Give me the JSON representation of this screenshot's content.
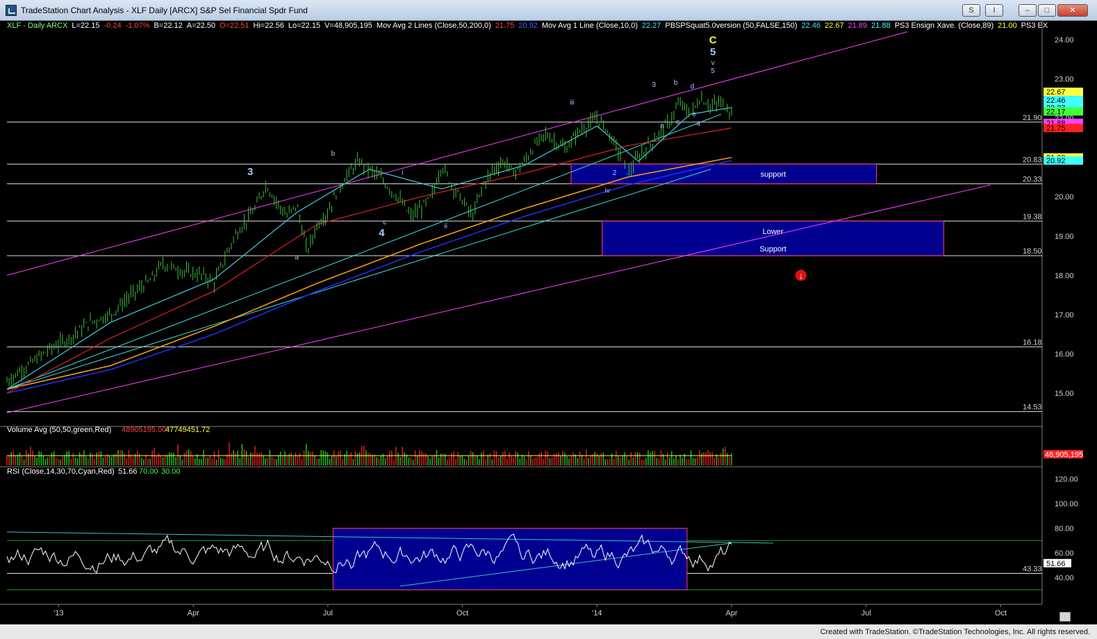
{
  "window": {
    "title": "TradeStation Chart Analysis - XLF Daily [ARCX] S&P Sel Financial Spdr Fund",
    "controls": [
      "S",
      "I",
      "–",
      "□",
      "✕"
    ]
  },
  "header": {
    "line": [
      {
        "text": "XLF - Daily  ARCX",
        "color": "#80ff80"
      },
      {
        "text": "L=22.15",
        "color": "#ffffff"
      },
      {
        "text": "-0.24",
        "color": "#ff4040"
      },
      {
        "text": "-1.07%",
        "color": "#ff4040"
      },
      {
        "text": "B=22.12",
        "color": "#ffffff"
      },
      {
        "text": "A=22.50",
        "color": "#ffffff"
      },
      {
        "text": "O=22.51",
        "color": "#ff4040"
      },
      {
        "text": "Hi=22.56",
        "color": "#ffffff"
      },
      {
        "text": "Lo=22.15",
        "color": "#ffffff"
      },
      {
        "text": "V=48,905,195",
        "color": "#ffffff"
      },
      {
        "text": "Mov Avg 2 Lines (Close,50,200,0)",
        "color": "#ffffff"
      },
      {
        "text": "21.75",
        "color": "#ff4040"
      },
      {
        "text": "20.92",
        "color": "#4060ff"
      },
      {
        "text": "Mov Avg 1 Line (Close,10,0)",
        "color": "#ffffff"
      },
      {
        "text": "22.27",
        "color": "#40e0ff"
      },
      {
        "text": "PBSPSquat5.0version (50,FALSE,150)",
        "color": "#ffffff"
      },
      {
        "text": "22.46",
        "color": "#40e0ff"
      },
      {
        "text": "22.67",
        "color": "#ffff40"
      },
      {
        "text": "21.89",
        "color": "#ff40ff"
      },
      {
        "text": "21.88",
        "color": "#40ffff"
      },
      {
        "text": "PS3 Ensign Xave. (Close,89)",
        "color": "#ffffff"
      },
      {
        "text": "21.00",
        "color": "#ffff40"
      },
      {
        "text": "PS3 EX",
        "color": "#ffffff"
      }
    ]
  },
  "chart_data": [
    {
      "type": "line",
      "subtype": "candlestick-price",
      "symbol": "XLF",
      "ylim": [
        14.4,
        24.3
      ],
      "yticks": [
        15.0,
        16.0,
        17.0,
        18.0,
        19.0,
        20.0,
        21.0,
        22.0,
        23.0,
        24.0
      ],
      "xlabels": [
        "'13",
        "Apr",
        "Jul",
        "Oct",
        "'14",
        "Apr",
        "Jul",
        "Oct"
      ],
      "x_positions": [
        0.05,
        0.18,
        0.31,
        0.44,
        0.57,
        0.7,
        0.83,
        0.96
      ],
      "price_path": [
        [
          0.0,
          15.3
        ],
        [
          0.02,
          15.7
        ],
        [
          0.04,
          16.1
        ],
        [
          0.06,
          16.4
        ],
        [
          0.08,
          16.8
        ],
        [
          0.1,
          17.0
        ],
        [
          0.12,
          17.5
        ],
        [
          0.14,
          17.9
        ],
        [
          0.15,
          18.3
        ],
        [
          0.17,
          18.1
        ],
        [
          0.19,
          18.0
        ],
        [
          0.2,
          17.8
        ],
        [
          0.21,
          18.4
        ],
        [
          0.22,
          19.0
        ],
        [
          0.24,
          19.7
        ],
        [
          0.25,
          20.3
        ],
        [
          0.26,
          19.9
        ],
        [
          0.27,
          19.5
        ],
        [
          0.28,
          19.8
        ],
        [
          0.29,
          18.6
        ],
        [
          0.3,
          19.3
        ],
        [
          0.31,
          19.6
        ],
        [
          0.32,
          20.2
        ],
        [
          0.33,
          20.6
        ],
        [
          0.34,
          20.9
        ],
        [
          0.35,
          20.7
        ],
        [
          0.36,
          20.5
        ],
        [
          0.37,
          20.2
        ],
        [
          0.38,
          19.9
        ],
        [
          0.39,
          19.5
        ],
        [
          0.4,
          19.7
        ],
        [
          0.41,
          20.0
        ],
        [
          0.42,
          20.8
        ],
        [
          0.43,
          20.3
        ],
        [
          0.44,
          19.9
        ],
        [
          0.45,
          19.5
        ],
        [
          0.46,
          20.3
        ],
        [
          0.47,
          20.7
        ],
        [
          0.48,
          20.9
        ],
        [
          0.49,
          20.6
        ],
        [
          0.5,
          20.9
        ],
        [
          0.51,
          21.3
        ],
        [
          0.52,
          21.6
        ],
        [
          0.53,
          21.4
        ],
        [
          0.54,
          21.2
        ],
        [
          0.55,
          21.6
        ],
        [
          0.56,
          21.8
        ],
        [
          0.57,
          22.0
        ],
        [
          0.58,
          21.7
        ],
        [
          0.59,
          21.2
        ],
        [
          0.6,
          20.6
        ],
        [
          0.61,
          21.0
        ],
        [
          0.62,
          21.3
        ],
        [
          0.63,
          21.6
        ],
        [
          0.64,
          21.9
        ],
        [
          0.65,
          22.4
        ],
        [
          0.66,
          22.1
        ],
        [
          0.67,
          22.5
        ],
        [
          0.68,
          22.3
        ],
        [
          0.69,
          22.4
        ],
        [
          0.7,
          22.15
        ]
      ],
      "ma10": [
        [
          0.0,
          15.1
        ],
        [
          0.1,
          16.8
        ],
        [
          0.2,
          17.9
        ],
        [
          0.28,
          19.6
        ],
        [
          0.35,
          20.7
        ],
        [
          0.42,
          20.2
        ],
        [
          0.5,
          20.8
        ],
        [
          0.57,
          21.8
        ],
        [
          0.61,
          20.9
        ],
        [
          0.66,
          22.1
        ],
        [
          0.7,
          22.27
        ]
      ],
      "ma50": [
        [
          0.0,
          15.0
        ],
        [
          0.1,
          16.4
        ],
        [
          0.2,
          17.6
        ],
        [
          0.3,
          19.3
        ],
        [
          0.4,
          20.0
        ],
        [
          0.5,
          20.6
        ],
        [
          0.6,
          21.3
        ],
        [
          0.7,
          21.75
        ]
      ],
      "ma200": [
        [
          0.0,
          15.0
        ],
        [
          0.1,
          15.6
        ],
        [
          0.2,
          16.5
        ],
        [
          0.3,
          17.6
        ],
        [
          0.4,
          18.6
        ],
        [
          0.5,
          19.5
        ],
        [
          0.6,
          20.3
        ],
        [
          0.7,
          20.92
        ]
      ],
      "ensign": [
        [
          0.0,
          15.1
        ],
        [
          0.1,
          15.7
        ],
        [
          0.2,
          16.7
        ],
        [
          0.3,
          17.8
        ],
        [
          0.4,
          18.8
        ],
        [
          0.5,
          19.7
        ],
        [
          0.6,
          20.5
        ],
        [
          0.7,
          21.0
        ]
      ],
      "horizontal_levels": [
        {
          "value": 21.9,
          "label": "21.90"
        },
        {
          "value": 20.83,
          "label": "20.83"
        },
        {
          "value": 20.33,
          "label": "20.33"
        },
        {
          "value": 19.38,
          "label": "19.38"
        },
        {
          "value": 18.5,
          "label": "18.50"
        },
        {
          "value": 16.18,
          "label": "16.18"
        },
        {
          "value": 14.53,
          "label": "14.53"
        }
      ],
      "boxes": [
        {
          "x0": 0.545,
          "x1": 0.84,
          "y0": 20.33,
          "y1": 20.83,
          "label": "support"
        },
        {
          "x0": 0.575,
          "x1": 0.905,
          "y0": 18.5,
          "y1": 19.38,
          "label": "Lower",
          "label2": "Support"
        }
      ],
      "channels": [
        {
          "x0": 0.0,
          "y0": 18.0,
          "x1": 0.87,
          "y1": 24.2,
          "color": "#ff40ff"
        },
        {
          "x0": 0.0,
          "y0": 14.5,
          "x1": 0.95,
          "y1": 20.3,
          "color": "#ff40ff"
        },
        {
          "x0": 0.0,
          "y0": 15.1,
          "x1": 0.69,
          "y1": 22.1,
          "color": "#40e0e0"
        },
        {
          "x0": 0.0,
          "y0": 15.1,
          "x1": 0.68,
          "y1": 20.7,
          "color": "#40e0e0"
        }
      ],
      "wave_labels": [
        {
          "x": 0.235,
          "y": 20.55,
          "text": "3",
          "big": true
        },
        {
          "x": 0.28,
          "y": 18.4,
          "text": "a"
        },
        {
          "x": 0.315,
          "y": 21.05,
          "text": "b"
        },
        {
          "x": 0.365,
          "y": 19.3,
          "text": "c"
        },
        {
          "x": 0.362,
          "y": 19.0,
          "text": "4",
          "big": true
        },
        {
          "x": 0.382,
          "y": 20.55,
          "text": "i"
        },
        {
          "x": 0.424,
          "y": 19.2,
          "text": "ii"
        },
        {
          "x": 0.546,
          "y": 22.35,
          "text": "iii"
        },
        {
          "x": 0.58,
          "y": 20.1,
          "text": "iv"
        },
        {
          "x": 0.587,
          "y": 20.55,
          "text": "2"
        },
        {
          "x": 0.625,
          "y": 22.8,
          "text": "3"
        },
        {
          "x": 0.633,
          "y": 21.75,
          "text": "a"
        },
        {
          "x": 0.646,
          "y": 22.85,
          "text": "b"
        },
        {
          "x": 0.648,
          "y": 21.85,
          "text": "c"
        },
        {
          "x": 0.662,
          "y": 22.75,
          "text": "d"
        },
        {
          "x": 0.664,
          "y": 22.05,
          "text": "e"
        },
        {
          "x": 0.668,
          "y": 21.8,
          "text": "4"
        },
        {
          "x": 0.682,
          "y": 23.9,
          "text": "C",
          "color": "#ffff40",
          "big": true
        },
        {
          "x": 0.682,
          "y": 23.6,
          "text": "5",
          "big": true
        },
        {
          "x": 0.682,
          "y": 23.35,
          "text": "v"
        },
        {
          "x": 0.682,
          "y": 23.15,
          "text": "5"
        }
      ],
      "price_tags": [
        {
          "value": 22.67,
          "label": "22.67",
          "bg": "#ffff40"
        },
        {
          "value": 22.46,
          "label": "22.46",
          "bg": "#40ffff"
        },
        {
          "value": 22.27,
          "label": "22.27",
          "bg": "#40ffff"
        },
        {
          "value": 22.17,
          "label": "22.17",
          "bg": "#40ff40"
        },
        {
          "value": 21.88,
          "label": "21.88",
          "bg": "#ff40ff"
        },
        {
          "value": 21.75,
          "label": "21.75",
          "bg": "#ff2020"
        },
        {
          "value": 21.0,
          "label": "21.00",
          "bg": "#ffff40"
        },
        {
          "value": 20.92,
          "label": "20.92",
          "bg": "#40ffff"
        }
      ]
    },
    {
      "type": "bar",
      "name": "Volume Avg (50,50,green,Red)",
      "values_text": [
        "48905195.00",
        "47749451.72"
      ],
      "value_colors": [
        "#ff4040",
        "#ffff40"
      ],
      "last_value": "48,905,195"
    },
    {
      "type": "line",
      "name": "RSI (Close,14,30,70,Cyan,Red)",
      "values_text": [
        "51.66",
        "70.00",
        "30.00"
      ],
      "value_colors": [
        "#ffffff",
        "#40ff40",
        "#40ff40"
      ],
      "ylim": [
        25,
        130
      ],
      "yticks": [
        40.0,
        60.0,
        80.0,
        100.0,
        120.0
      ],
      "last_value": "51.66",
      "level": {
        "value": 43.33,
        "label": "43.33"
      },
      "box": {
        "x0": 0.315,
        "x1": 0.657,
        "y0": 30,
        "y1": 80
      }
    }
  ],
  "footer": {
    "credit": "Created with TradeStation. ©TradeStation Technologies, Inc. All rights reserved."
  }
}
